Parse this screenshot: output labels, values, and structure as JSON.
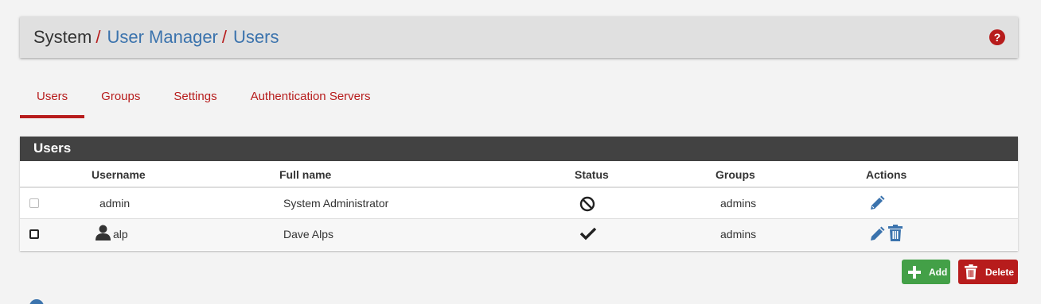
{
  "breadcrumb": {
    "root": "System",
    "separator": "/",
    "items": [
      "User Manager",
      "Users"
    ]
  },
  "help_icon": "question-circle",
  "tabs": [
    {
      "label": "Users",
      "active": true
    },
    {
      "label": "Groups",
      "active": false
    },
    {
      "label": "Settings",
      "active": false
    },
    {
      "label": "Authentication Servers",
      "active": false
    }
  ],
  "panel": {
    "title": "Users",
    "columns": [
      "Username",
      "Full name",
      "Status",
      "Groups",
      "Actions"
    ],
    "rows": [
      {
        "checkbox_enabled": false,
        "user_icon": false,
        "username": "admin",
        "fullname": "System Administrator",
        "status_icon": "ban-icon",
        "groups": "admins",
        "actions": [
          "edit-icon"
        ]
      },
      {
        "checkbox_enabled": true,
        "user_icon": true,
        "username": "alp",
        "fullname": "Dave Alps",
        "status_icon": "check-icon",
        "groups": "admins",
        "actions": [
          "edit-icon",
          "trash-icon"
        ]
      }
    ]
  },
  "buttons": {
    "add_label": "Add",
    "delete_label": "Delete"
  },
  "colors": {
    "accent_red": "#b71c1c",
    "link_blue": "#3b73ad",
    "add_green": "#43a047",
    "panel_heading": "#424242"
  }
}
